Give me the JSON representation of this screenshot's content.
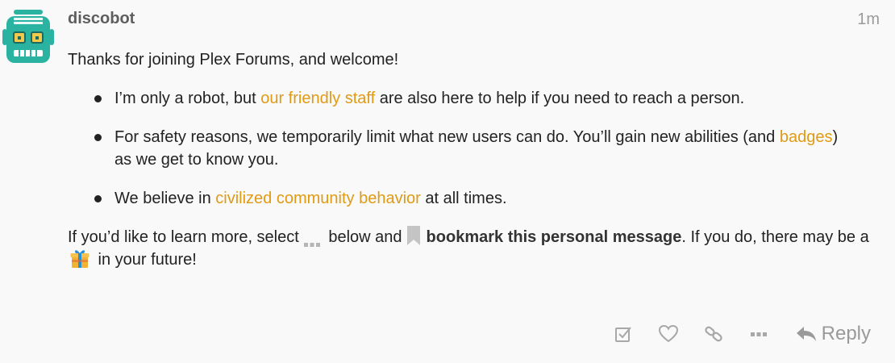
{
  "post": {
    "username": "discobot",
    "date": "1m",
    "avatar_icon": "robot-avatar-icon",
    "intro": "Thanks for joining Plex Forums, and welcome!",
    "bullets": [
      {
        "before": "I’m only a robot, but ",
        "link": "our friendly staff",
        "after": " are also here to help if you need to reach a person."
      },
      {
        "before": "For safety reasons, we temporarily limit what new users can do. You’ll gain new abilities (and ",
        "link": "badges",
        "after": ") as we get to know you."
      },
      {
        "before": "We believe in ",
        "link": "civilized community behavior",
        "after": " at all times."
      }
    ],
    "outro": {
      "part1": "If you’d like to learn more, select",
      "part2": " below and",
      "bold": "bookmark this personal message",
      "part3": ". If you do, there may be a",
      "part4": " in your future!",
      "icons": [
        "ellipsis-icon",
        "bookmark-icon",
        "gift-icon"
      ]
    }
  },
  "actions": {
    "icons": [
      "checkbox-icon",
      "heart-icon",
      "link-icon",
      "more-icon",
      "reply-icon"
    ],
    "reply_label": "Reply"
  },
  "colors": {
    "background": "#f9f9f9",
    "link": "#e09a14",
    "text": "#222222",
    "muted": "#9a9a9a",
    "avatar_teal": "#2bb3a1",
    "avatar_yellow": "#f2c94c"
  }
}
